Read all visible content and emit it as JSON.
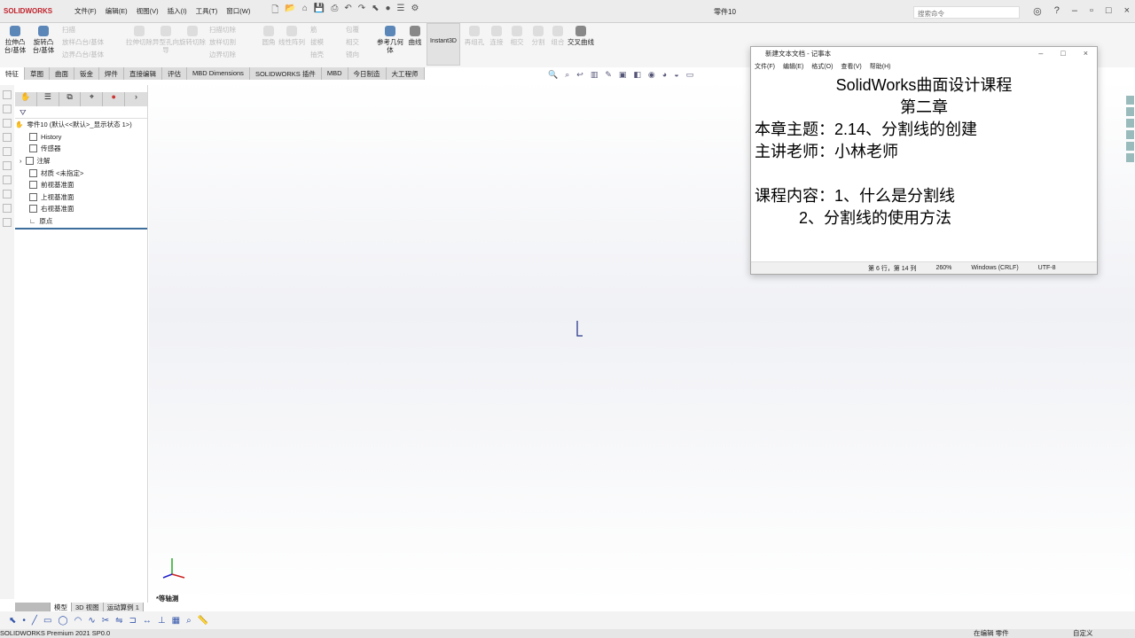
{
  "app": {
    "logo": "SOLIDWORKS",
    "doc_title": "零件10",
    "search_placeholder": "搜索命令"
  },
  "menu": [
    "文件(F)",
    "编辑(E)",
    "视图(V)",
    "插入(I)",
    "工具(T)",
    "窗口(W)"
  ],
  "ribbon": {
    "items": [
      {
        "label": "拉伸凸台/基体",
        "enabled": true
      },
      {
        "label": "旋转凸台/基体",
        "enabled": true
      },
      {
        "label": "扫描",
        "enabled": false
      },
      {
        "label": "放样凸台/基体",
        "enabled": false
      },
      {
        "label": "边界凸台/基体",
        "enabled": false
      },
      {
        "label": "拉伸切除",
        "enabled": false
      },
      {
        "label": "异型孔向导",
        "enabled": false
      },
      {
        "label": "旋转切除",
        "enabled": false
      },
      {
        "label": "扫描切除",
        "enabled": false
      },
      {
        "label": "放样切割",
        "enabled": false
      },
      {
        "label": "边界切除",
        "enabled": false
      },
      {
        "label": "圆角",
        "enabled": false
      },
      {
        "label": "线性阵列",
        "enabled": false
      },
      {
        "label": "筋",
        "enabled": false
      },
      {
        "label": "拔模",
        "enabled": false
      },
      {
        "label": "抽壳",
        "enabled": false
      },
      {
        "label": "包覆",
        "enabled": false
      },
      {
        "label": "相交",
        "enabled": false
      },
      {
        "label": "镜向",
        "enabled": false
      },
      {
        "label": "参考几何体",
        "enabled": true
      },
      {
        "label": "曲线",
        "enabled": true
      },
      {
        "label": "Instant3D",
        "enabled": true
      },
      {
        "label": "再组孔",
        "enabled": false
      },
      {
        "label": "连接",
        "enabled": false
      },
      {
        "label": "相交",
        "enabled": false
      },
      {
        "label": "分割",
        "enabled": false
      },
      {
        "label": "组合",
        "enabled": false
      },
      {
        "label": "交叉曲线",
        "enabled": true
      }
    ]
  },
  "tabs": [
    "特征",
    "草图",
    "曲面",
    "钣金",
    "焊件",
    "直接编辑",
    "评估",
    "MBD Dimensions",
    "SOLIDWORKS 插件",
    "MBD",
    "今日制造",
    "大工程师"
  ],
  "tree": {
    "root": "零件10 (默认<<默认>_显示状态 1>)",
    "items": [
      "History",
      "传感器",
      "注解",
      "材质 <未指定>",
      "前视基准面",
      "上视基准面",
      "右视基准面",
      "原点"
    ]
  },
  "view": {
    "orientation": "*等轴测"
  },
  "notepad": {
    "title": "新建文本文档 - 记事本",
    "menu": [
      "文件(F)",
      "编辑(E)",
      "格式(O)",
      "查看(V)",
      "帮助(H)"
    ],
    "lines": [
      "SolidWorks曲面设计课程",
      "第二章",
      "本章主题：2.14、分割线的创建",
      "主讲老师：小林老师",
      "",
      "课程内容：1、什么是分割线",
      "          2、分割线的使用方法"
    ],
    "status": {
      "position": "第 6 行，第 14 列",
      "zoom": "260%",
      "eol": "Windows (CRLF)",
      "encoding": "UTF-8"
    }
  },
  "bottom_tabs": [
    "模型",
    "3D 视图",
    "运动算例 1"
  ],
  "status": {
    "version": "SOLIDWORKS Premium 2021 SP0.0",
    "mode": "在编辑 零件",
    "custom": "自定义"
  }
}
